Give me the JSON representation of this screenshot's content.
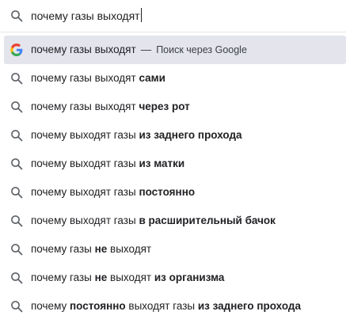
{
  "search": {
    "value": "почему газы выходят"
  },
  "colors": {
    "highlight": "#e3e4ec",
    "text": "#202124",
    "google_blue": "#4285F4",
    "google_red": "#EA4335",
    "google_yellow": "#FBBC05",
    "google_green": "#34A853"
  },
  "suggestions": [
    {
      "icon": "google-icon",
      "parts": [
        {
          "t": "почему газы выходят",
          "b": false
        }
      ],
      "separator": "—",
      "provider": "Поиск через Google"
    },
    {
      "icon": "search-icon",
      "parts": [
        {
          "t": "почему газы выходят ",
          "b": false
        },
        {
          "t": "сами",
          "b": true
        }
      ]
    },
    {
      "icon": "search-icon",
      "parts": [
        {
          "t": "почему газы выходят ",
          "b": false
        },
        {
          "t": "через рот",
          "b": true
        }
      ]
    },
    {
      "icon": "search-icon",
      "parts": [
        {
          "t": "почему выходят газы ",
          "b": false
        },
        {
          "t": "из заднего прохода",
          "b": true
        }
      ]
    },
    {
      "icon": "search-icon",
      "parts": [
        {
          "t": "почему выходят газы ",
          "b": false
        },
        {
          "t": "из матки",
          "b": true
        }
      ]
    },
    {
      "icon": "search-icon",
      "parts": [
        {
          "t": "почему выходят газы ",
          "b": false
        },
        {
          "t": "постоянно",
          "b": true
        }
      ]
    },
    {
      "icon": "search-icon",
      "parts": [
        {
          "t": "почему выходят газы ",
          "b": false
        },
        {
          "t": "в расширительный бачок",
          "b": true
        }
      ]
    },
    {
      "icon": "search-icon",
      "parts": [
        {
          "t": "почему газы ",
          "b": false
        },
        {
          "t": "не",
          "b": true
        },
        {
          "t": " выходят",
          "b": false
        }
      ]
    },
    {
      "icon": "search-icon",
      "parts": [
        {
          "t": "почему газы ",
          "b": false
        },
        {
          "t": "не",
          "b": true
        },
        {
          "t": " выходят ",
          "b": false
        },
        {
          "t": "из организма",
          "b": true
        }
      ]
    },
    {
      "icon": "search-icon",
      "parts": [
        {
          "t": "почему ",
          "b": false
        },
        {
          "t": "постоянно",
          "b": true
        },
        {
          "t": " выходят газы ",
          "b": false
        },
        {
          "t": "из заднего прохода",
          "b": true
        }
      ]
    }
  ]
}
